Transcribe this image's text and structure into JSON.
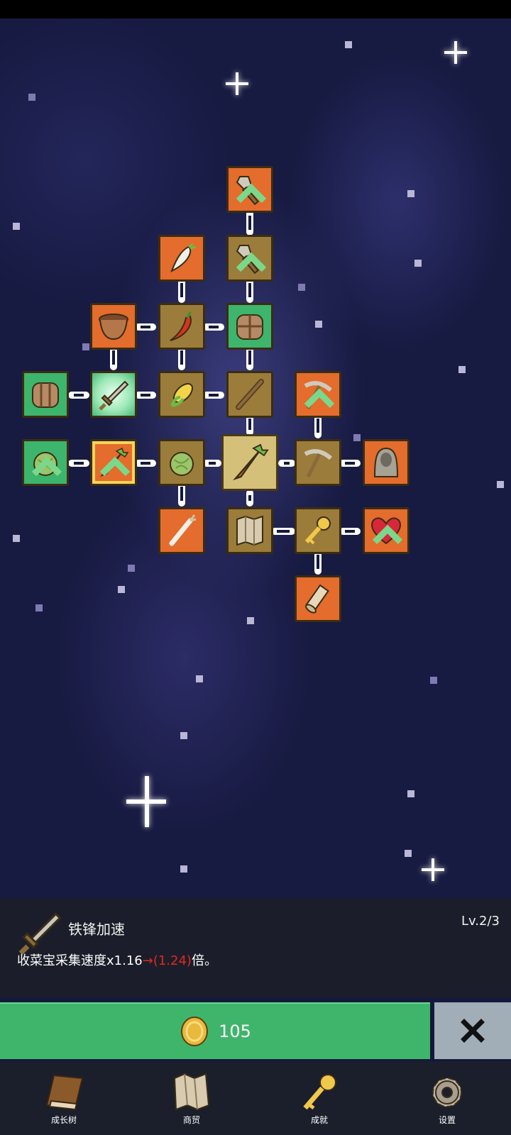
{
  "skill_tree": {
    "nodes": [
      {
        "id": "shovel-top",
        "icon": "shovel-icon",
        "tier": "orange",
        "upgradable": true
      },
      {
        "id": "radish",
        "icon": "radish-icon",
        "tier": "orange",
        "upgradable": false
      },
      {
        "id": "shovel-2",
        "icon": "shovel-icon",
        "tier": "gold",
        "upgradable": true
      },
      {
        "id": "pot",
        "icon": "clay-pot-icon",
        "tier": "orange",
        "upgradable": false
      },
      {
        "id": "chili",
        "icon": "chili-pepper-icon",
        "tier": "gold",
        "upgradable": false
      },
      {
        "id": "backpack-green",
        "icon": "backpack-icon",
        "tier": "green",
        "upgradable": false
      },
      {
        "id": "backpack-left",
        "icon": "backpack-icon",
        "tier": "green",
        "upgradable": false
      },
      {
        "id": "sword-current",
        "icon": "sword-icon",
        "tier": "glow",
        "upgradable": false
      },
      {
        "id": "corn",
        "icon": "corn-icon",
        "tier": "gold",
        "upgradable": false
      },
      {
        "id": "stick",
        "icon": "wooden-stick-icon",
        "tier": "gold",
        "upgradable": false
      },
      {
        "id": "pickaxe-top",
        "icon": "pickaxe-icon",
        "tier": "orange",
        "upgradable": true
      },
      {
        "id": "cabbage-left",
        "icon": "cabbage-icon",
        "tier": "green",
        "upgradable": true
      },
      {
        "id": "carrot-framed",
        "icon": "carrot-icon",
        "tier": "framed",
        "upgradable": true
      },
      {
        "id": "cabbage-mid",
        "icon": "cabbage-icon",
        "tier": "gold",
        "upgradable": false
      },
      {
        "id": "carrot-root",
        "icon": "carrot-icon",
        "tier": "selected",
        "upgradable": false
      },
      {
        "id": "pickaxe",
        "icon": "pickaxe-icon",
        "tier": "gold",
        "upgradable": false
      },
      {
        "id": "hooded-figure",
        "icon": "hooded-figure-icon",
        "tier": "orange",
        "upgradable": false
      },
      {
        "id": "leek",
        "icon": "leek-icon",
        "tier": "orange",
        "upgradable": false
      },
      {
        "id": "map",
        "icon": "map-icon",
        "tier": "gold",
        "upgradable": false
      },
      {
        "id": "key",
        "icon": "key-icon",
        "tier": "gold",
        "upgradable": false
      },
      {
        "id": "heart",
        "icon": "heart-icon",
        "tier": "orange",
        "upgradable": true
      },
      {
        "id": "scroll",
        "icon": "scroll-icon",
        "tier": "orange",
        "upgradable": false
      }
    ]
  },
  "selected_skill": {
    "icon": "sword-icon",
    "name": "铁锋加速",
    "level": "Lv.2/3",
    "desc_prefix": "收菜宝采集速度x1.16",
    "desc_arrow": "→",
    "desc_next": "(1.24)",
    "desc_suffix": "倍。"
  },
  "buy_button": {
    "icon": "gold-coin-icon",
    "price": "105"
  },
  "close_button": {
    "icon": "close-x-icon"
  },
  "bottom_nav": [
    {
      "icon": "book-icon",
      "label": "成长树"
    },
    {
      "icon": "map-icon",
      "label": "商贸"
    },
    {
      "icon": "key-icon",
      "label": "成就"
    },
    {
      "icon": "gear-icon",
      "label": "设置"
    }
  ],
  "colors": {
    "orange": "#e46c2c",
    "gold": "#9c7c3a",
    "green": "#3db56c",
    "buy_green": "#3fb56b",
    "highlight_red": "#e0281e"
  }
}
